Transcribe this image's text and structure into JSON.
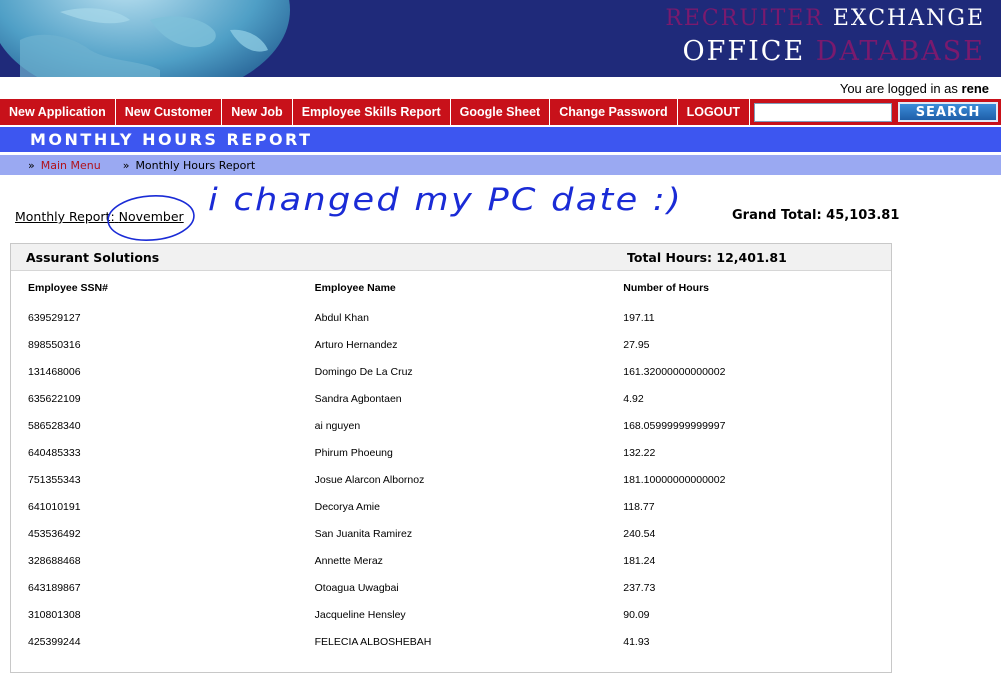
{
  "brand": {
    "line1_word1": "RECRUITER",
    "line1_word2": "EXCHANGE",
    "line2_word1": "OFFICE",
    "line2_word2": "DATABASE"
  },
  "login": {
    "prefix": "You are logged in as",
    "username": "rene"
  },
  "nav": {
    "items": [
      "New Application",
      "New Customer",
      "New Job",
      "Employee Skills Report",
      "Google Sheet",
      "Change Password",
      "LOGOUT"
    ],
    "search_value": "",
    "search_button": "SEARCH"
  },
  "page_title": "MONTHLY HOURS REPORT",
  "breadcrumb": {
    "separator": "»",
    "link": "Main Menu",
    "current": "Monthly Hours Report"
  },
  "report": {
    "label_prefix": "Monthly Report:",
    "month": "November",
    "grand_total": "Grand Total: 45,103.81"
  },
  "annotation": {
    "handwritten_text": "i changed my PC date :)"
  },
  "panel": {
    "company": "Assurant Solutions",
    "total_hours": "Total Hours: 12,401.81",
    "columns": [
      "Employee SSN#",
      "Employee Name",
      "Number of Hours"
    ],
    "rows": [
      [
        "639529127",
        "Abdul Khan",
        "197.11"
      ],
      [
        "898550316",
        "Arturo Hernandez",
        "27.95"
      ],
      [
        "131468006",
        "Domingo De La Cruz",
        "161.32000000000002"
      ],
      [
        "635622109",
        "Sandra Agbontaen",
        "4.92"
      ],
      [
        "586528340",
        "ai nguyen",
        "168.05999999999997"
      ],
      [
        "640485333",
        "Phirum Phoeung",
        "132.22"
      ],
      [
        "751355343",
        "Josue Alarcon Albornoz",
        "181.10000000000002"
      ],
      [
        "641010191",
        "Decorya Amie",
        "118.77"
      ],
      [
        "453536492",
        "San Juanita Ramirez",
        "240.54"
      ],
      [
        "328688468",
        "Annette Meraz",
        "181.24"
      ],
      [
        "643189867",
        "Otoagua Uwagbai",
        "237.73"
      ],
      [
        "310801308",
        "Jacqueline Hensley",
        "90.09"
      ],
      [
        "425399244",
        "FELECIA ALBOSHEBAH",
        "41.93"
      ]
    ]
  },
  "colors": {
    "banner": "#1f2a7a",
    "nav_red": "#c8111a",
    "title_blue": "#3d56f0",
    "breadcrumb_blue": "#9aa9f2",
    "brand_purple": "#7a1a6e",
    "annotation_ink": "#1a2bd6"
  }
}
